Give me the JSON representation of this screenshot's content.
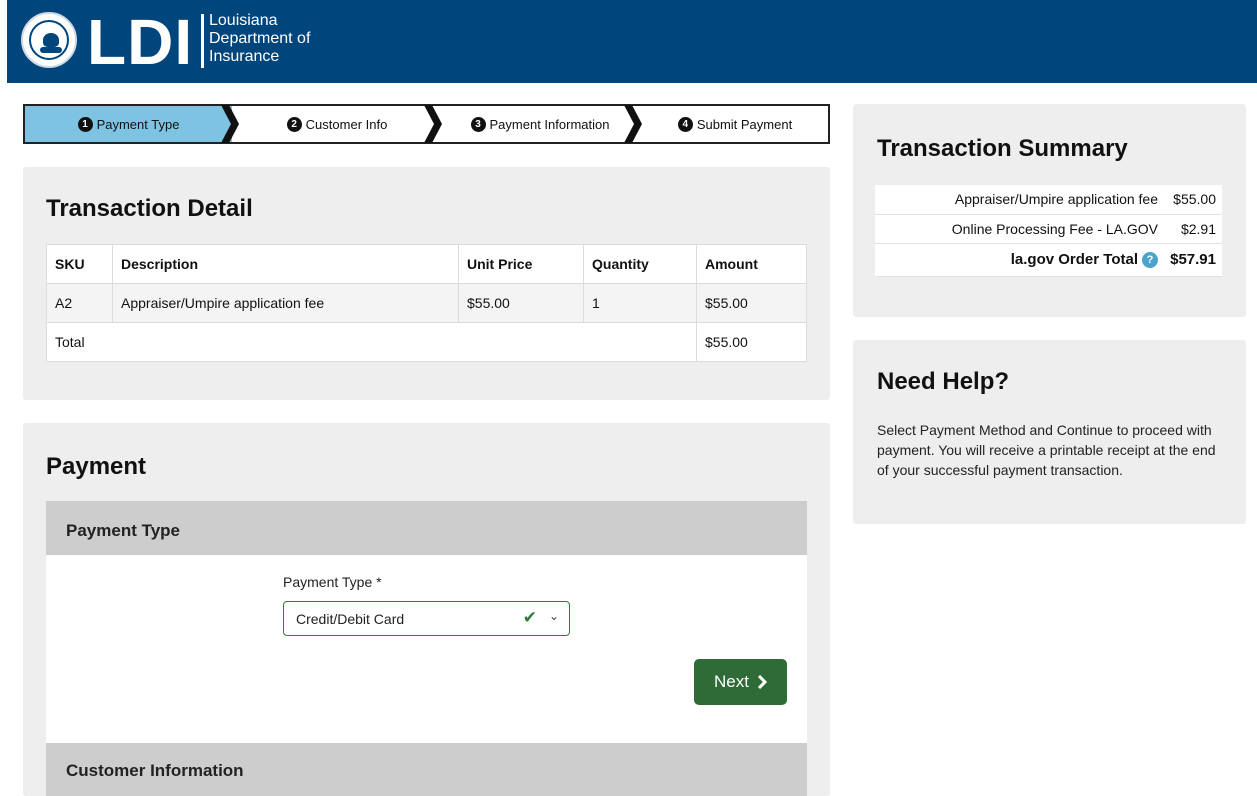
{
  "header": {
    "logo_text": "LDI",
    "org_lines": [
      "Louisiana",
      "Department of",
      "Insurance"
    ],
    "seal_icon": "state-seal-icon",
    "bg_color": "#00457c"
  },
  "stepper": {
    "steps": [
      {
        "num": "1",
        "label": "Payment Type",
        "active": true
      },
      {
        "num": "2",
        "label": "Customer Info",
        "active": false
      },
      {
        "num": "3",
        "label": "Payment Information",
        "active": false
      },
      {
        "num": "4",
        "label": "Submit Payment",
        "active": false
      }
    ],
    "active_color": "#7ec4e2"
  },
  "transaction_detail": {
    "title": "Transaction Detail",
    "columns": [
      "SKU",
      "Description",
      "Unit Price",
      "Quantity",
      "Amount"
    ],
    "rows": [
      {
        "sku": "A2",
        "description": "Appraiser/Umpire application fee",
        "unit_price": "$55.00",
        "quantity": "1",
        "amount": "$55.00"
      }
    ],
    "total_label": "Total",
    "total_amount": "$55.00"
  },
  "payment": {
    "title": "Payment",
    "section_title": "Payment Type",
    "field_label": "Payment Type *",
    "selected_value": "Credit/Debit Card",
    "next_label": "Next",
    "next_color": "#2e6b36",
    "next_section_title": "Customer Information"
  },
  "summary": {
    "title": "Transaction Summary",
    "lines": [
      {
        "label": "Appraiser/Umpire application fee",
        "amount": "$55.00"
      },
      {
        "label": "Online Processing Fee - LA.GOV",
        "amount": "$2.91"
      }
    ],
    "total_label": "la.gov Order Total",
    "total_amount": "$57.91",
    "help_glyph": "?"
  },
  "help": {
    "title": "Need Help?",
    "text": "Select Payment Method and Continue to proceed with payment. You will receive a printable receipt at the end of your successful payment transaction."
  }
}
